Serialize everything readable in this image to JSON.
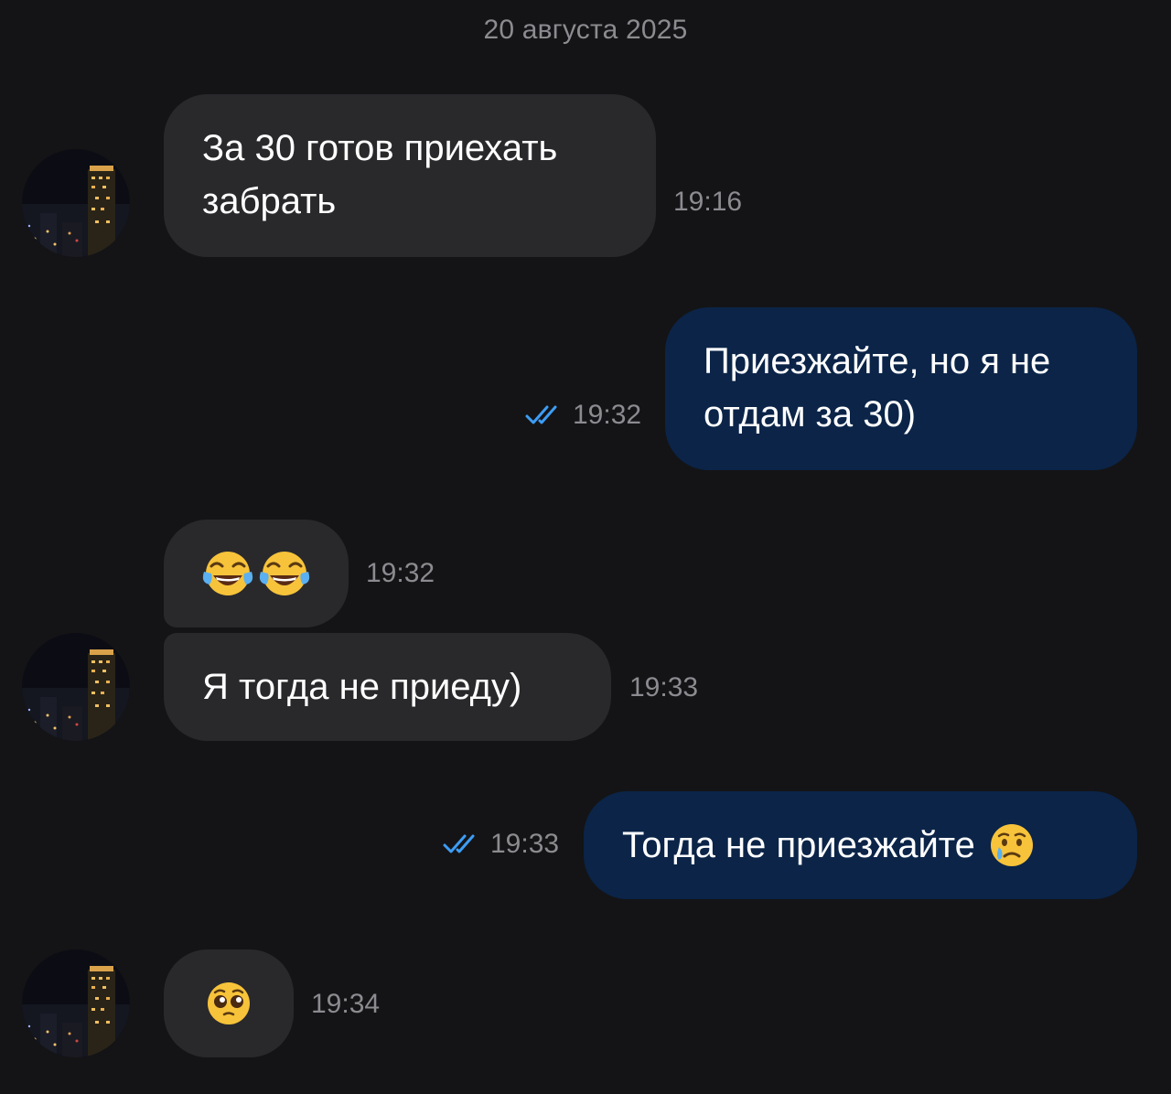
{
  "chat": {
    "date_separator": "20 августа 2025",
    "messages": [
      {
        "direction": "incoming",
        "lines": [
          "За 30 готов приехать",
          "забрать"
        ],
        "time": "19:16"
      },
      {
        "direction": "outgoing",
        "lines": [
          "Приезжайте, но я не",
          "отдам за 30)"
        ],
        "time": "19:32",
        "status": "read"
      },
      {
        "direction": "incoming",
        "emoji": [
          "face-with-tears-of-joy",
          "face-with-tears-of-joy"
        ],
        "time": "19:32"
      },
      {
        "direction": "incoming",
        "text": "Я тогда не приеду)",
        "time": "19:33"
      },
      {
        "direction": "outgoing",
        "text": "Тогда не приезжайте",
        "emoji": [
          "crying-face"
        ],
        "time": "19:33",
        "status": "read"
      },
      {
        "direction": "incoming",
        "emoji": [
          "pleading-face"
        ],
        "time": "19:34"
      }
    ]
  },
  "colors": {
    "background": "#141416",
    "incoming_bubble": "#29292c",
    "outgoing_bubble": "#0b2448",
    "meta_text": "#8b8b90",
    "read_checks": "#3d9df5"
  },
  "icons": {
    "avatar": "night-city-skyscraper-photo",
    "read_status": "double-check-icon"
  }
}
